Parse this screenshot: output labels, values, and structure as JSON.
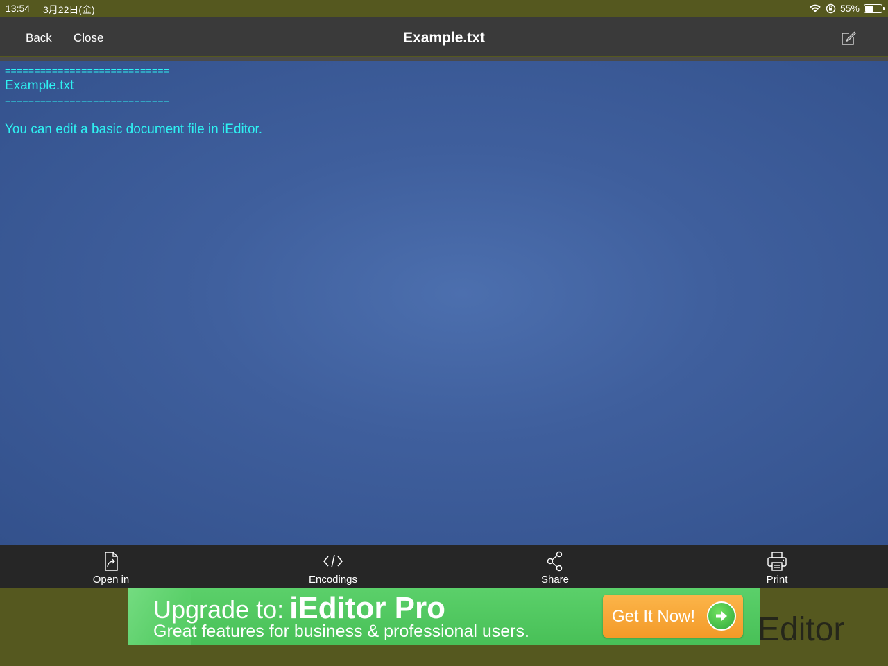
{
  "status_bar": {
    "time": "13:54",
    "date": "3月22日(金)",
    "battery_text": "55%",
    "battery_level": 0.55,
    "icons": [
      "wifi-icon",
      "orientation-lock-icon",
      "battery-icon"
    ]
  },
  "nav": {
    "back_label": "Back",
    "close_label": "Close",
    "title": "Example.txt",
    "edit_icon": "compose-icon"
  },
  "editor": {
    "lines": [
      "============================",
      "Example.txt",
      "============================",
      "",
      "You can edit a basic document file in iEditor."
    ],
    "text_color": "#2ef2f2"
  },
  "toolbar": {
    "items": [
      {
        "label": "Open in",
        "icon": "open-in-icon"
      },
      {
        "label": "Encodings",
        "icon": "code-icon"
      },
      {
        "label": "Share",
        "icon": "share-icon"
      },
      {
        "label": "Print",
        "icon": "print-icon"
      }
    ]
  },
  "ad": {
    "line1_prefix": "Upgrade to:",
    "line1_product": "iEditor Pro",
    "line2": "Great features for business & professional users.",
    "cta_label": "Get It Now!",
    "background_text": "Editor",
    "banner_color": "#52c862",
    "cta_color": "#f7a534"
  }
}
